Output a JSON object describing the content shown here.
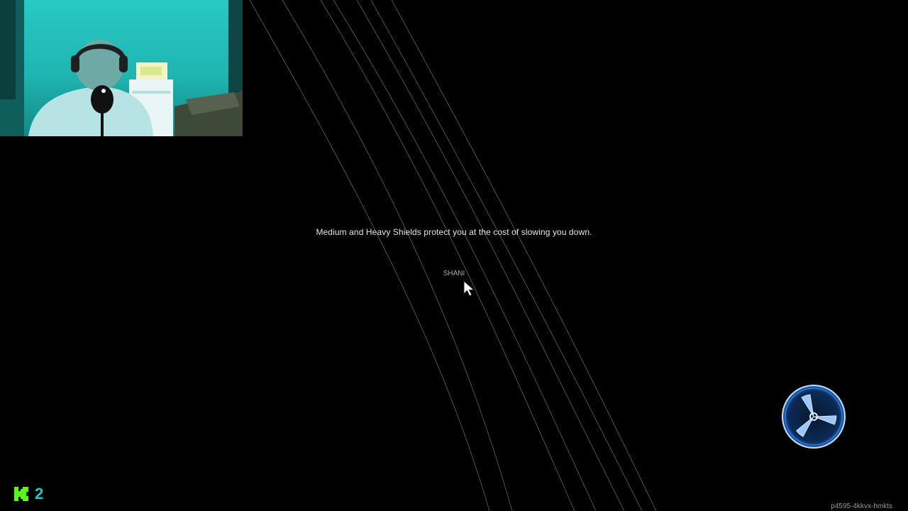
{
  "loading_screen": {
    "tip_text": "Medium and Heavy Shields protect you at the cost of slowing you down.",
    "player_name": "SHANI"
  },
  "overlay": {
    "brand_logo_icon": "kick-logo-icon",
    "brand_logo_color": "#53fc18",
    "viewer_count": "2",
    "session_code": "p4595-4kkvx-hmkts"
  },
  "webcam": {
    "icon": "streamer-webcam-feed",
    "tint_color": "#29c9c4"
  },
  "loader": {
    "icon": "radial-spinner-icon",
    "color": "#5aa9ff"
  }
}
